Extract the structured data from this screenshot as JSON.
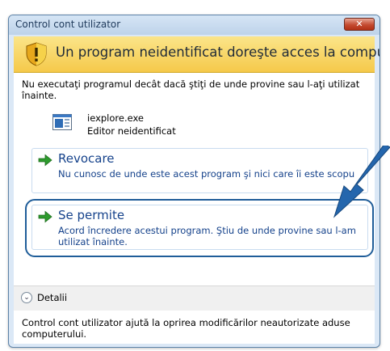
{
  "window": {
    "title": "Control cont utilizator",
    "close_label": "✕"
  },
  "banner": {
    "text": "Un program neidentificat doreşte acces la computer"
  },
  "body": {
    "warning": "Nu executaţi programul decât dacă ştiţi de unde provine sau l-aţi utilizat înainte.",
    "program_name": "iexplore.exe",
    "publisher": "Editor neidentificat"
  },
  "options": {
    "deny": {
      "title": "Revocare",
      "description": "Nu cunosc de unde este acest program şi nici care îi este scopu"
    },
    "allow": {
      "title": "Se permite",
      "description": "Acord încredere acestui program. Ştiu de unde provine sau l-am utilizat înainte."
    }
  },
  "details": {
    "label": "Detalii"
  },
  "footer": {
    "text": "Control cont utilizator ajută la oprirea modificărilor neautorizate aduse computerului."
  },
  "colors": {
    "option_text": "#15428b",
    "banner_bg": "#f5c94a",
    "highlight": "#1f5d99"
  }
}
